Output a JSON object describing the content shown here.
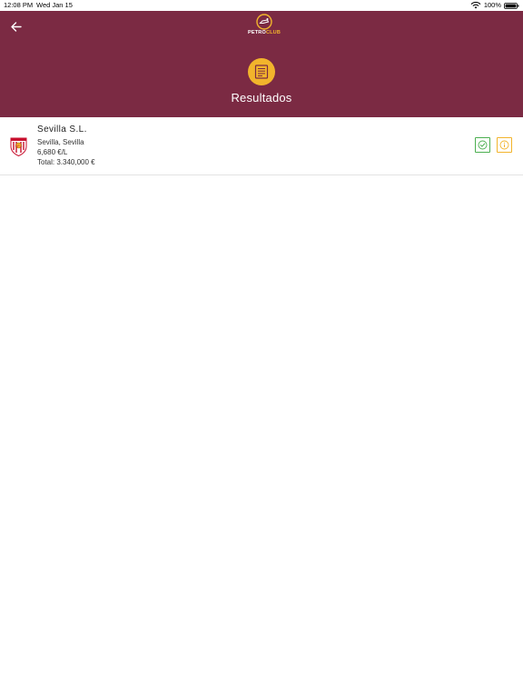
{
  "status_bar": {
    "time": "12:08 PM",
    "date": "Wed Jan 15",
    "battery_percent": "100%"
  },
  "header": {
    "back_icon": "arrow-left-icon",
    "logo_text_primary": "PETRO",
    "logo_text_accent": "CLUB",
    "title_icon": "list-document-icon",
    "title": "Resultados",
    "background_color": "#7b2a43",
    "accent_color": "#f2b42c"
  },
  "results": [
    {
      "crest_icon": "sevilla-fc-crest-icon",
      "name": "Sevilla S.L.",
      "location": "Sevilla, Sevilla",
      "price": "6,680 €/L",
      "total": "Total: 3.340,000 €",
      "confirm_icon": "check-circle-icon",
      "info_icon": "info-circle-icon"
    }
  ]
}
